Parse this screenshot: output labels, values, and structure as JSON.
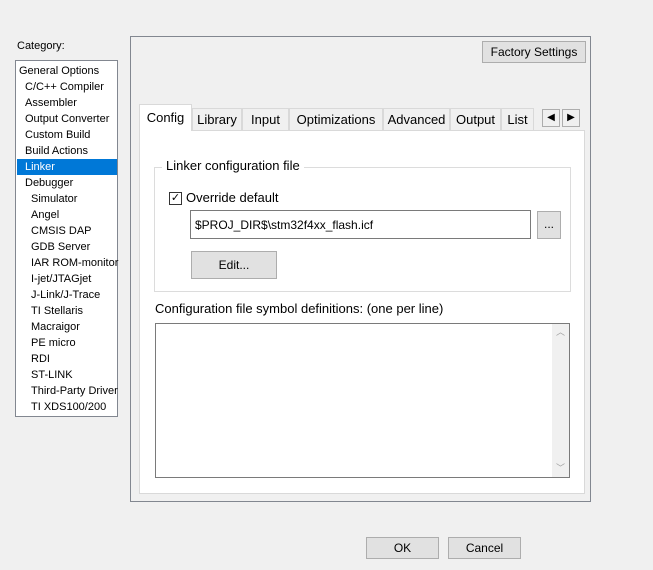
{
  "category": {
    "label": "Category:",
    "items": [
      {
        "label": "General Options",
        "level": 0,
        "selected": false
      },
      {
        "label": "C/C++ Compiler",
        "level": 1,
        "selected": false
      },
      {
        "label": "Assembler",
        "level": 1,
        "selected": false
      },
      {
        "label": "Output Converter",
        "level": 1,
        "selected": false
      },
      {
        "label": "Custom Build",
        "level": 1,
        "selected": false
      },
      {
        "label": "Build Actions",
        "level": 1,
        "selected": false
      },
      {
        "label": "Linker",
        "level": 1,
        "selected": true
      },
      {
        "label": "Debugger",
        "level": 1,
        "selected": false
      },
      {
        "label": "Simulator",
        "level": 2,
        "selected": false
      },
      {
        "label": "Angel",
        "level": 2,
        "selected": false
      },
      {
        "label": "CMSIS DAP",
        "level": 2,
        "selected": false
      },
      {
        "label": "GDB Server",
        "level": 2,
        "selected": false
      },
      {
        "label": "IAR ROM-monitor",
        "level": 2,
        "selected": false
      },
      {
        "label": "I-jet/JTAGjet",
        "level": 2,
        "selected": false
      },
      {
        "label": "J-Link/J-Trace",
        "level": 2,
        "selected": false
      },
      {
        "label": "TI Stellaris",
        "level": 2,
        "selected": false
      },
      {
        "label": "Macraigor",
        "level": 2,
        "selected": false
      },
      {
        "label": "PE micro",
        "level": 2,
        "selected": false
      },
      {
        "label": "RDI",
        "level": 2,
        "selected": false
      },
      {
        "label": "ST-LINK",
        "level": 2,
        "selected": false
      },
      {
        "label": "Third-Party Driver",
        "level": 2,
        "selected": false
      },
      {
        "label": "TI XDS100/200",
        "level": 2,
        "selected": false
      }
    ]
  },
  "panel": {
    "factory_settings": "Factory Settings",
    "tabs": [
      {
        "label": "Config",
        "active": true
      },
      {
        "label": "Library",
        "active": false
      },
      {
        "label": "Input",
        "active": false
      },
      {
        "label": "Optimizations",
        "active": false
      },
      {
        "label": "Advanced",
        "active": false
      },
      {
        "label": "Output",
        "active": false
      },
      {
        "label": "List",
        "active": false
      }
    ],
    "tab_scroll_left": "◀",
    "tab_scroll_right": "▶",
    "linker_group_title": "Linker configuration file",
    "override_checked": true,
    "override_label": "Override default",
    "config_file_value": "$PROJ_DIR$\\stm32f4xx_flash.icf",
    "browse_label": "...",
    "edit_label": "Edit...",
    "symbol_label": "Configuration file symbol definitions: (one per line)",
    "symbol_value": ""
  },
  "dialog": {
    "ok": "OK",
    "cancel": "Cancel"
  }
}
